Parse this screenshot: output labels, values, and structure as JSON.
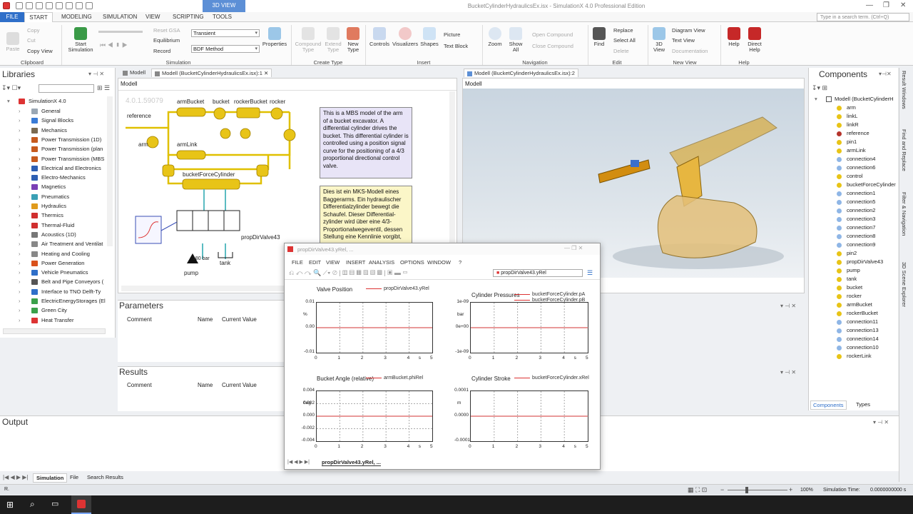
{
  "window": {
    "title": "BucketCylinderHydraulicsEx.isx - SimulationX 4.0 Professional Edition",
    "context_tab": "3D VIEW"
  },
  "search": {
    "placeholder": "Type in a search term. (Ctrl+Q)"
  },
  "ribbon_tabs": [
    "FILE",
    "START",
    "MODELING",
    "SIMULATION",
    "VIEW",
    "SCRIPTING",
    "TOOLS"
  ],
  "ribbon": {
    "clipboard": {
      "paste": "Paste",
      "copy": "Copy",
      "cut": "Cut",
      "copy_view": "Copy View",
      "group": "Clipboard"
    },
    "simulation": {
      "start": "Start Simulation",
      "reset": "Reset GSA",
      "equilibrium": "Equilibrium",
      "record": "Record",
      "mode": "Transient",
      "method": "BDF Method",
      "properties": "Properties",
      "group": "Simulation"
    },
    "create_type": {
      "compound": "Compound Type",
      "extend": "Extend Type",
      "new": "New Type",
      "group": "Create Type"
    },
    "insert": {
      "controls": "Controls",
      "visualizers": "Visualizers",
      "shapes": "Shapes",
      "picture": "Picture",
      "text_block": "Text Block",
      "group": "Insert"
    },
    "navigation": {
      "zoom": "Zoom",
      "show_all": "Show All",
      "open_compound": "Open Compound",
      "close_compound": "Close Compound",
      "group": "Navigation"
    },
    "edit": {
      "find": "Find",
      "replace": "Replace",
      "select_all": "Select All",
      "delete": "Delete",
      "group": "Edit"
    },
    "new_view": {
      "view3d": "3D View",
      "diagram": "Diagram View",
      "text": "Text View",
      "documentation": "Documentation",
      "group": "New View"
    },
    "help": {
      "help": "Help",
      "direct_help": "Direct Help",
      "group": "Help"
    }
  },
  "libraries": {
    "title": "Libraries",
    "root": "SimulationX 4.0",
    "items": [
      "General",
      "Signal Blocks",
      "Mechanics",
      "Power Transmission (1D)",
      "Power Transmission (plan",
      "Power Transmission (MBS",
      "Electrical and Electronics",
      "Electro-Mechanics",
      "Magnetics",
      "Pneumatics",
      "Hydraulics",
      "Thermics",
      "Thermal-Fluid",
      "Acoustics (1D)",
      "Air Treatment and Ventilat",
      "Heating and Cooling",
      "Power Generation",
      "Vehicle Pneumatics",
      "Belt and Pipe Conveyors (",
      "Interface to TNO Delft-Ty",
      "ElectricEnergyStorages (El",
      "Green City",
      "Heat Transfer"
    ]
  },
  "doc_tabs": [
    "Modell",
    "Modell (BucketCylinderHydraulicsEx.isx):1"
  ],
  "doc": {
    "subtab": "Modell",
    "version": "4.0.1.59079",
    "labels": {
      "reference": "reference",
      "armBucket": "armBucket",
      "bucket": "bucket",
      "rockerBucket": "rockerBucket",
      "rocker": "rocker",
      "arm": "arm",
      "armLink": "armLink",
      "linkL": "linkL",
      "linkR": "linkR",
      "pin1": "pin1",
      "pin2": "pin2",
      "rockerLink": "rockerLink",
      "cyl": "bucketForceCylinder",
      "valve": "propDirValve43",
      "pump": "pump",
      "tank": "tank",
      "control": "control",
      "pressure": "180 bar"
    },
    "note_en": "This is a MBS model of the arm of a bucket excavator. A differential cylinder drives the bucket. This differential cylinder is controlled using a position signal curve for the positioning of a 4/3 proportional directional control valve.",
    "note_de": "Dies ist ein MKS-Modell eines Baggerarms. Ein hydraulischer Differentialzylinder bewegt die Schaufel. Dieser Differential-zylinder wird über eine 4/3-Proportionalwegeventil, dessen Stellung eine Kennlinie vorgibt,"
  },
  "view3d": {
    "tab": "Modell (BucketCylinderHydraulicsEx.isx):2",
    "subtab": "Modell"
  },
  "parameters": {
    "title": "Parameters",
    "cols": [
      "Comment",
      "Name",
      "Current Value"
    ]
  },
  "results": {
    "title": "Results",
    "cols": [
      "Comment",
      "Name",
      "Current Value"
    ]
  },
  "output": {
    "title": "Output"
  },
  "bottom_tabs": [
    "Simulation",
    "File",
    "Search Results"
  ],
  "status": {
    "left": "R.",
    "zoom": "100%",
    "sim_time": "Simulation Time:",
    "sim_time_val": "0.0000000000 s"
  },
  "components": {
    "title": "Components",
    "root": "Modell (BucketCylinderH",
    "items": [
      "arm",
      "linkL",
      "linkR",
      "reference",
      "pin1",
      "armLink",
      "connection4",
      "connection6",
      "control",
      "bucketForceCylinder",
      "connection1",
      "connection5",
      "connection2",
      "connection3",
      "connection7",
      "connection8",
      "connection9",
      "pin2",
      "propDirValve43",
      "pump",
      "tank",
      "bucket",
      "rocker",
      "armBucket",
      "rockerBucket",
      "connection11",
      "connection13",
      "connection14",
      "connection10",
      "rockerLink"
    ],
    "tabs": [
      "Components",
      "Types"
    ]
  },
  "side_tabs": [
    "Result Windows",
    "Find and Replace",
    "Filter & Navigation",
    "3D Scene Explorer"
  ],
  "plot_window": {
    "title": "propDirValve43.yRel, ...",
    "menu": [
      "FILE",
      "EDIT",
      "VIEW",
      "INSERT",
      "ANALYSIS",
      "OPTIONS",
      "WINDOW",
      "?"
    ],
    "selector": "propDirValve43.yRel",
    "page_tab": "propDirValve43.yRel, ..."
  },
  "colors": {
    "accent": "#2f6fc9",
    "curve": "#d33333"
  },
  "chart_data": [
    {
      "type": "line",
      "title": "Valve Position",
      "series": [
        {
          "name": "propDirValve43.yRel",
          "x": [
            0,
            5
          ],
          "y": [
            0,
            0
          ]
        }
      ],
      "ylabel": "%",
      "xlabel": "s",
      "ylim": [
        -0.01,
        0.01
      ],
      "yticks": [
        "0.01",
        "0.00",
        "-0.01"
      ],
      "xticks": [
        "0",
        "1",
        "2",
        "3",
        "4",
        "s",
        "5"
      ]
    },
    {
      "type": "line",
      "title": "Cylinder Pressures",
      "series": [
        {
          "name": "bucketForceCylinder.pA",
          "x": [
            0,
            5
          ],
          "y": [
            0,
            0
          ]
        },
        {
          "name": "bucketForceCylinder.pB",
          "x": [
            0,
            5
          ],
          "y": [
            0,
            0
          ]
        }
      ],
      "ylabel": "bar",
      "xlabel": "s",
      "ylim": [
        -1e-09,
        1e-09
      ],
      "yticks": [
        "1e-09",
        "0e+00",
        "-1e-09"
      ],
      "xticks": [
        "0",
        "1",
        "2",
        "3",
        "4",
        "s",
        "5"
      ]
    },
    {
      "type": "line",
      "title": "Bucket Angle (relative)",
      "series": [
        {
          "name": "armBucket.phiRel",
          "x": [
            0,
            5
          ],
          "y": [
            0,
            0
          ]
        }
      ],
      "ylabel": "deg",
      "xlabel": "s",
      "ylim": [
        -0.005,
        0.005
      ],
      "yticks": [
        "0.004",
        "0.002",
        "0.000",
        "-0.002",
        "-0.004"
      ],
      "xticks": [
        "0",
        "1",
        "2",
        "3",
        "4",
        "s",
        "5"
      ]
    },
    {
      "type": "line",
      "title": "Cylinder Stroke",
      "series": [
        {
          "name": "bucketForceCylinder.xRel",
          "x": [
            0,
            5
          ],
          "y": [
            0,
            0
          ]
        }
      ],
      "ylabel": "m",
      "xlabel": "s",
      "ylim": [
        -0.0001,
        0.0001
      ],
      "yticks": [
        "0.0001",
        "0.0000",
        "-0.0001"
      ],
      "xticks": [
        "0",
        "1",
        "2",
        "3",
        "4",
        "s",
        "5"
      ]
    }
  ]
}
